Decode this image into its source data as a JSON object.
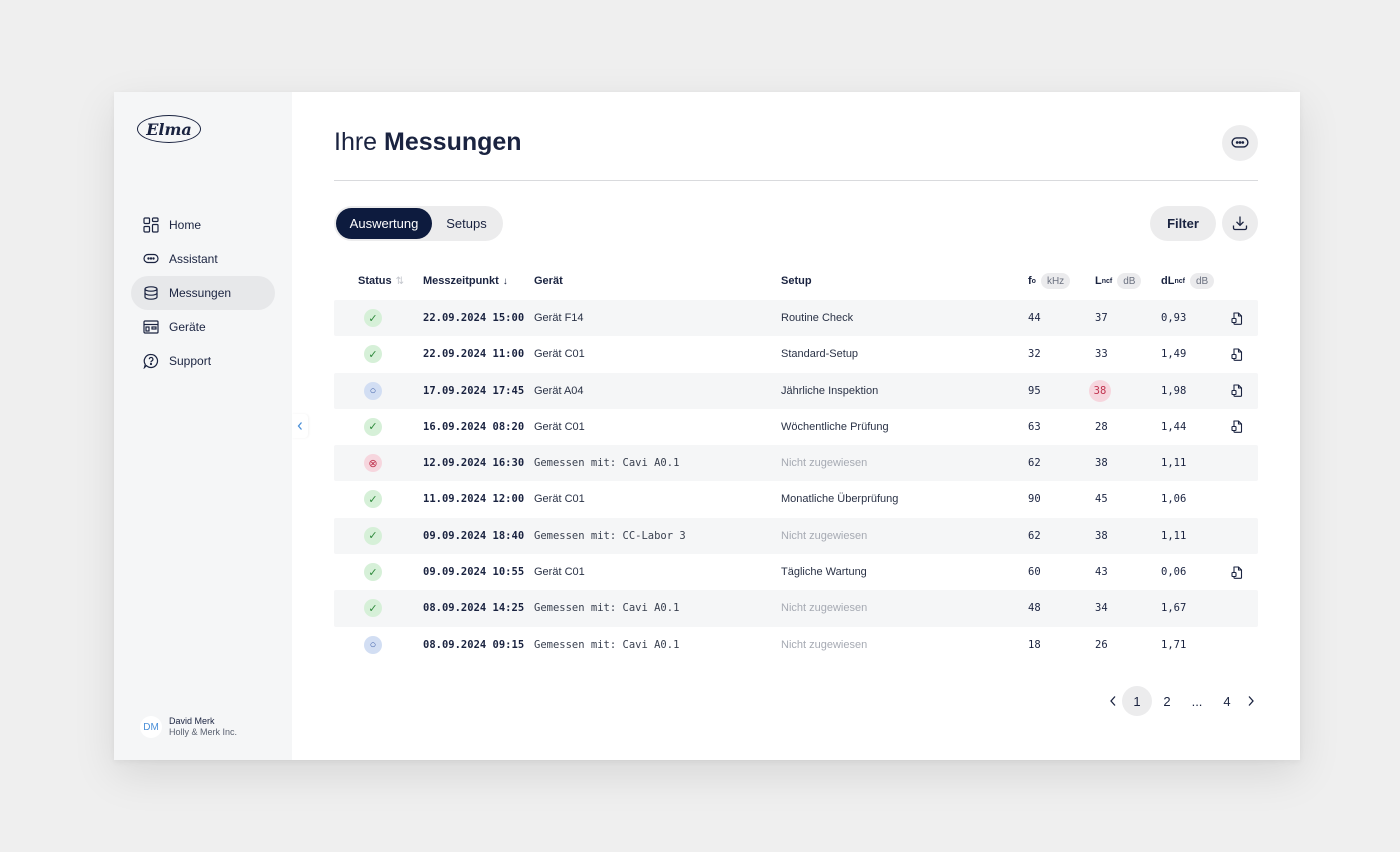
{
  "sidebar": {
    "logo_text": "Elma",
    "items": [
      {
        "label": "Home",
        "icon": "grid-icon",
        "active": false
      },
      {
        "label": "Assistant",
        "icon": "chat-bubble-icon",
        "active": false
      },
      {
        "label": "Messungen",
        "icon": "cylinder-icon",
        "active": true
      },
      {
        "label": "Geräte",
        "icon": "device-icon",
        "active": false
      },
      {
        "label": "Support",
        "icon": "help-bubble-icon",
        "active": false
      }
    ],
    "user": {
      "initials": "DM",
      "name": "David Merk",
      "company": "Holly & Merk Inc."
    }
  },
  "header": {
    "title_light": "Ihre ",
    "title_bold": "Messungen"
  },
  "toolbar": {
    "tabs": [
      {
        "label": "Auswertung",
        "active": true
      },
      {
        "label": "Setups",
        "active": false
      }
    ],
    "filter_label": "Filter"
  },
  "table": {
    "columns": {
      "status": "Status",
      "time": "Messzeitpunkt",
      "device": "Gerät",
      "setup": "Setup",
      "f0": "f",
      "f0_sub": "o",
      "f0_unit": "kHz",
      "lncf": "L",
      "lncf_sub": "ncf",
      "lncf_unit": "dB",
      "dlncf": "dL",
      "dlncf_sub": "ncf",
      "dlncf_unit": "dB"
    },
    "rows": [
      {
        "status": "ok",
        "time": "22.09.2024 15:00",
        "device": "Gerät F14",
        "device_measured": false,
        "setup": "Routine Check",
        "setup_assigned": true,
        "f0": "44",
        "lncf": "37",
        "lncf_flag": false,
        "dlncf": "0,93",
        "report": true
      },
      {
        "status": "ok",
        "time": "22.09.2024 11:00",
        "device": "Gerät C01",
        "device_measured": false,
        "setup": "Standard-Setup",
        "setup_assigned": true,
        "f0": "32",
        "lncf": "33",
        "lncf_flag": false,
        "dlncf": "1,49",
        "report": true
      },
      {
        "status": "pending",
        "time": "17.09.2024 17:45",
        "device": "Gerät A04",
        "device_measured": false,
        "setup": "Jährliche Inspektion",
        "setup_assigned": true,
        "f0": "95",
        "lncf": "38",
        "lncf_flag": true,
        "dlncf": "1,98",
        "report": true
      },
      {
        "status": "ok",
        "time": "16.09.2024 08:20",
        "device": "Gerät C01",
        "device_measured": false,
        "setup": "Wöchentliche Prüfung",
        "setup_assigned": true,
        "f0": "63",
        "lncf": "28",
        "lncf_flag": false,
        "dlncf": "1,44",
        "report": true
      },
      {
        "status": "error",
        "time": "12.09.2024 16:30",
        "device": "Gemessen mit: Cavi A0.1",
        "device_measured": true,
        "setup": "Nicht zugewiesen",
        "setup_assigned": false,
        "f0": "62",
        "lncf": "38",
        "lncf_flag": false,
        "dlncf": "1,11",
        "report": false
      },
      {
        "status": "ok",
        "time": "11.09.2024 12:00",
        "device": "Gerät C01",
        "device_measured": false,
        "setup": "Monatliche Überprüfung",
        "setup_assigned": true,
        "f0": "90",
        "lncf": "45",
        "lncf_flag": false,
        "dlncf": "1,06",
        "report": false
      },
      {
        "status": "ok",
        "time": "09.09.2024 18:40",
        "device": "Gemessen mit: CC-Labor 3",
        "device_measured": true,
        "setup": "Nicht zugewiesen",
        "setup_assigned": false,
        "f0": "62",
        "lncf": "38",
        "lncf_flag": false,
        "dlncf": "1,11",
        "report": false
      },
      {
        "status": "ok",
        "time": "09.09.2024 10:55",
        "device": "Gerät C01",
        "device_measured": false,
        "setup": "Tägliche Wartung",
        "setup_assigned": true,
        "f0": "60",
        "lncf": "43",
        "lncf_flag": false,
        "dlncf": "0,06",
        "report": true
      },
      {
        "status": "ok",
        "time": "08.09.2024 14:25",
        "device": "Gemessen mit: Cavi A0.1",
        "device_measured": true,
        "setup": "Nicht zugewiesen",
        "setup_assigned": false,
        "f0": "48",
        "lncf": "34",
        "lncf_flag": false,
        "dlncf": "1,67",
        "report": false
      },
      {
        "status": "pending",
        "time": "08.09.2024 09:15",
        "device": "Gemessen mit: Cavi A0.1",
        "device_measured": true,
        "setup": "Nicht zugewiesen",
        "setup_assigned": false,
        "f0": "18",
        "lncf": "26",
        "lncf_flag": false,
        "dlncf": "1,71",
        "report": false
      }
    ]
  },
  "pagination": {
    "pages": [
      "1",
      "2",
      "...",
      "4"
    ],
    "current": "1"
  },
  "colors": {
    "primary": "#0d1b3e",
    "ok": "#2f8a3c",
    "pending": "#3e5fa8",
    "error": "#c0334f"
  }
}
